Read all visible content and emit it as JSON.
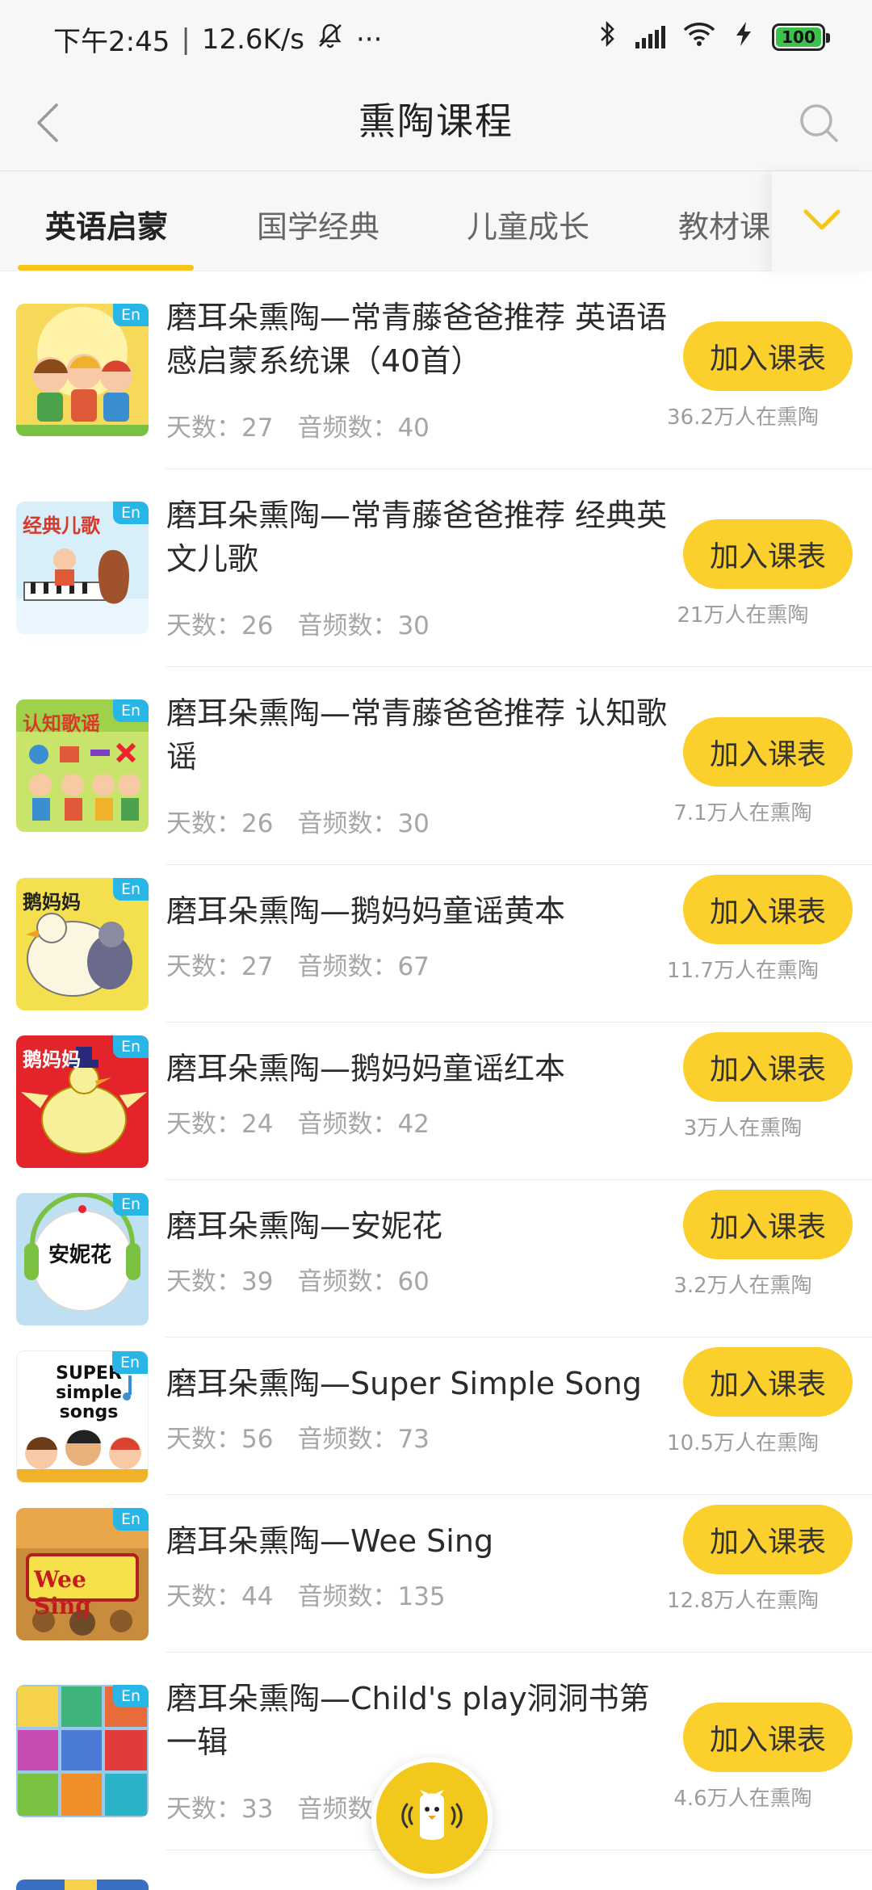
{
  "status_bar": {
    "time": "下午2:45",
    "net_speed": "12.6K/s",
    "battery": "100",
    "more": "···"
  },
  "nav": {
    "title": "熏陶课程"
  },
  "tabs": [
    {
      "label": "英语启蒙",
      "active": true
    },
    {
      "label": "国学经典",
      "active": false
    },
    {
      "label": "儿童成长",
      "active": false
    },
    {
      "label": "教材课",
      "active": false
    }
  ],
  "courses": [
    {
      "cover_text": "",
      "title": "磨耳朵熏陶—常青藤爸爸推荐 英语语感启蒙系统课（40首）",
      "days_label": "天数：27",
      "audio_label": "音频数：40",
      "button": "加入课表",
      "learners": "36.2万人在熏陶",
      "badge": "En",
      "cover_color": "#f7d95a"
    },
    {
      "cover_text": "经典儿歌",
      "title": "磨耳朵熏陶—常青藤爸爸推荐 经典英文儿歌",
      "days_label": "天数：26",
      "audio_label": "音频数：30",
      "button": "加入课表",
      "learners": "21万人在熏陶",
      "badge": "En",
      "cover_color": "#d8eef8"
    },
    {
      "cover_text": "认知歌谣",
      "title": "磨耳朵熏陶—常青藤爸爸推荐 认知歌谣",
      "days_label": "天数：26",
      "audio_label": "音频数：30",
      "button": "加入课表",
      "learners": "7.1万人在熏陶",
      "badge": "En",
      "cover_color": "#c8e46a"
    },
    {
      "cover_text": "鹅妈妈",
      "title": "磨耳朵熏陶—鹅妈妈童谣黄本",
      "days_label": "天数：27",
      "audio_label": "音频数：67",
      "button": "加入课表",
      "learners": "11.7万人在熏陶",
      "badge": "En",
      "cover_color": "#f4e04e"
    },
    {
      "cover_text": "鹅妈妈",
      "title": "磨耳朵熏陶—鹅妈妈童谣红本",
      "days_label": "天数：24",
      "audio_label": "音频数：42",
      "button": "加入课表",
      "learners": "3万人在熏陶",
      "badge": "En",
      "cover_color": "#e4242b"
    },
    {
      "cover_text": "安妮花",
      "title": "磨耳朵熏陶—安妮花",
      "days_label": "天数：39",
      "audio_label": "音频数：60",
      "button": "加入课表",
      "learners": "3.2万人在熏陶",
      "badge": "En",
      "cover_color": "#bfe0f2"
    },
    {
      "cover_text": "SUPER simple songs",
      "title": "磨耳朵熏陶—Super Simple Song",
      "days_label": "天数：56",
      "audio_label": "音频数：73",
      "button": "加入课表",
      "learners": "10.5万人在熏陶",
      "badge": "En",
      "cover_color": "#ffffff"
    },
    {
      "cover_text": "Wee Sing",
      "title": "磨耳朵熏陶—Wee Sing",
      "days_label": "天数：44",
      "audio_label": "音频数：135",
      "button": "加入课表",
      "learners": "12.8万人在熏陶",
      "badge": "En",
      "cover_color": "#c98b3c"
    },
    {
      "cover_text": "",
      "title": "磨耳朵熏陶—Child's play洞洞书第一辑",
      "days_label": "天数：33",
      "audio_label": "音频数：",
      "button": "加入课表",
      "learners": "4.6万人在熏陶",
      "badge": "En",
      "cover_color": "#9bc7e8"
    }
  ],
  "colors": {
    "accent": "#fbcf2c",
    "badge": "#27b6e6",
    "tab_underline": "#f5c518"
  }
}
